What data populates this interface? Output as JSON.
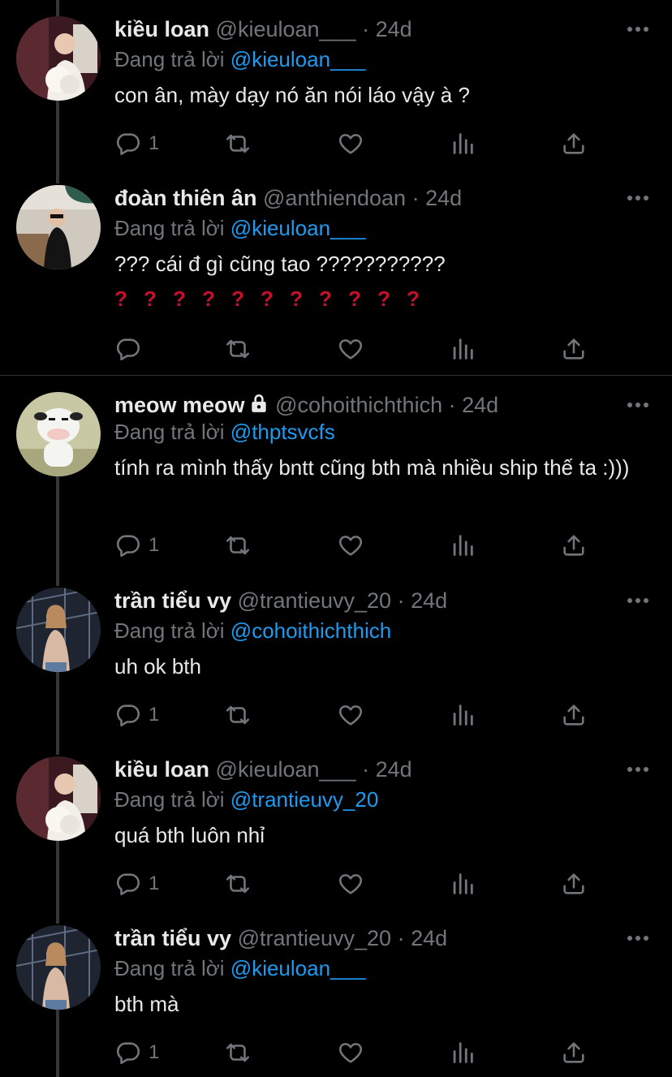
{
  "tweets": [
    {
      "name": "kiều loan",
      "handle": "@kieuloan___",
      "time": "24d",
      "replying_prefix": "Đang trả lời",
      "replying_to": "@kieuloan___",
      "text": "con ân, mày dạy nó ăn nói láo vậy à ?",
      "reply_count": "1",
      "avatar_icon": "avatar-photo"
    },
    {
      "name": "đoàn thiên ân",
      "handle": "@anthiendoan",
      "time": "24d",
      "replying_prefix": "Đang trả lời",
      "replying_to": "@kieuloan___",
      "text": "??? cái đ gì cũng tao ???????????",
      "emoji_line": [
        "?",
        "?",
        "?",
        "?",
        "?",
        "?",
        "?",
        "?",
        "?",
        "?",
        "?"
      ],
      "reply_count": "",
      "avatar_icon": "avatar-photo"
    },
    {
      "name": "meow meow",
      "handle": "@cohoithichthich",
      "time": "24d",
      "replying_prefix": "Đang trả lời",
      "replying_to": "@thptsvcfs",
      "text": "tính ra mình thấy bntt cũng bth mà nhiều ship thế ta :)))",
      "reply_count": "1",
      "avatar_icon": "cow-avatar"
    },
    {
      "name": "trần tiểu vy",
      "handle": "@trantieuvy_20",
      "time": "24d",
      "replying_prefix": "Đang trả lời",
      "replying_to": "@cohoithichthich",
      "text": "uh ok bth",
      "reply_count": "1",
      "avatar_icon": "avatar-photo"
    },
    {
      "name": "kiều loan",
      "handle": "@kieuloan___",
      "time": "24d",
      "replying_prefix": "Đang trả lời",
      "replying_to": "@trantieuvy_20",
      "text": "quá bth luôn nhỉ",
      "reply_count": "1",
      "avatar_icon": "avatar-photo"
    },
    {
      "name": "trần tiểu vy",
      "handle": "@trantieuvy_20",
      "time": "24d",
      "replying_prefix": "Đang trả lời",
      "replying_to": "@kieuloan___",
      "text": "bth mà",
      "reply_count": "1",
      "avatar_icon": "avatar-photo"
    }
  ],
  "separator": "·",
  "icons": {
    "reply": "reply-icon",
    "retweet": "retweet-icon",
    "like": "heart-icon",
    "analytics": "analytics-icon",
    "share": "share-icon",
    "more": "more-icon",
    "lock": "lock-icon"
  },
  "colors": {
    "background": "#000000",
    "text": "#e7e9ea",
    "muted": "#71767b",
    "link": "#1d9bf0",
    "thread_line": "#333639",
    "emoji_red": "#c8102e"
  }
}
